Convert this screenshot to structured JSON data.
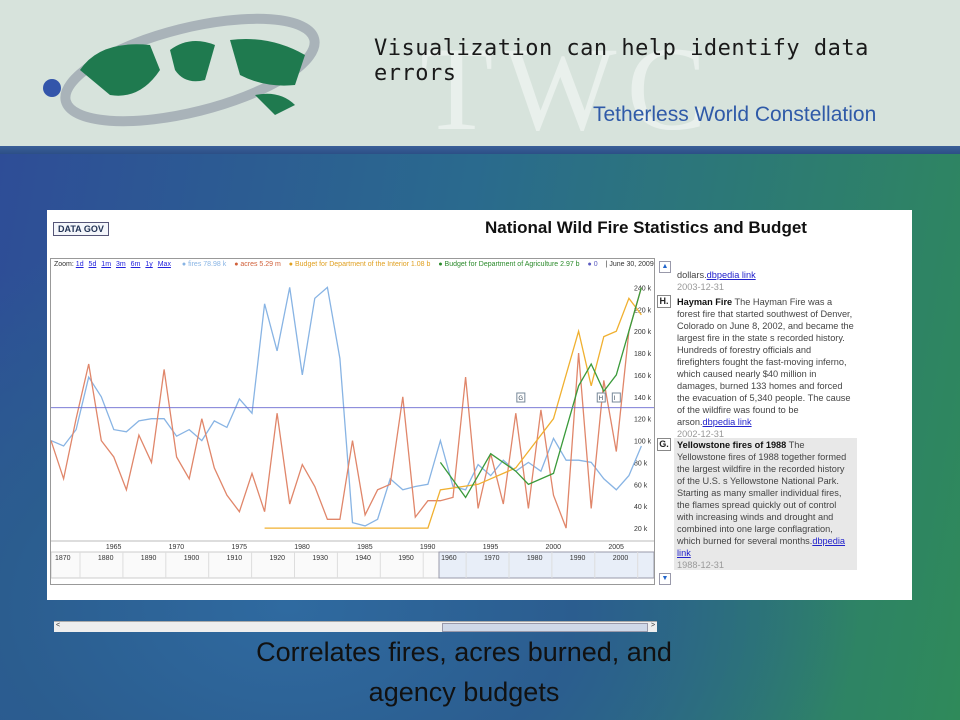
{
  "header": {
    "slide_title": "Visualization can help identify data errors",
    "org_name": "Tetherless World Constellation",
    "watermark": "TWC"
  },
  "colors": {
    "fires": "#88b4e4",
    "acres": "#e0866a",
    "interior_budget": "#f0b030",
    "agriculture_budget": "#3a9a3a",
    "zero": "#6a6ad0"
  },
  "chart": {
    "badge": "DATA GOV",
    "title": "National Wild Fire Statistics and Budget",
    "zoom_label": "Zoom:",
    "zoom_links": [
      "1d",
      "5d",
      "1m",
      "3m",
      "6m",
      "1y",
      "Max"
    ],
    "legend": [
      {
        "label": "fires 78.98 k",
        "color": "#88b4e4"
      },
      {
        "label": "acres 5.29 m",
        "color": "#e0866a"
      },
      {
        "label": "Budget for Department of the Interior 1.08 b",
        "color": "#f0b030"
      },
      {
        "label": "Budget for Department of Agriculture 2.97 b",
        "color": "#3a9a3a"
      },
      {
        "label": "0",
        "color": "#6a6ad0"
      }
    ],
    "date_label": "June 30, 2009",
    "annotations": [
      {
        "letter": "",
        "text_tail": "dollars.",
        "link": "dbpedia link",
        "date": "2003-12-31"
      },
      {
        "letter": "H.",
        "title": "Hayman Fire",
        "text": "The Hayman Fire was a forest fire that started southwest of Denver, Colorado on June 8, 2002, and became the largest fire in the state s recorded history. Hundreds of forestry officials and firefighters fought the fast-moving inferno, which caused nearly $40 million in damages, burned 133 homes and forced the evacuation of 5,340 people. The cause of the wildfire was found to be arson.",
        "link": "dbpedia link",
        "date": "2002-12-31"
      },
      {
        "letter": "G.",
        "title": "Yellowstone fires of 1988",
        "text": "The Yellowstone fires of 1988 together formed the largest wildfire in the recorded history of the U.S. s Yellowstone National Park. Starting as many smaller individual fires, the flames spread quickly out of control with increasing winds and drought and combined into one large conflagration, which burned for several months.",
        "link": "dbpedia link",
        "date": "1988-12-31"
      }
    ]
  },
  "chart_data": {
    "type": "line",
    "title": "National Wild Fire Statistics and Budget",
    "x_unit": "year",
    "y_axis_ticks": [
      "20 k",
      "40 k",
      "60 k",
      "80 k",
      "100 k",
      "120 k",
      "140 k",
      "160 k",
      "180 k",
      "200 k",
      "220 k",
      "240 k"
    ],
    "ylim": [
      10,
      255
    ],
    "x_ticks": [
      1965,
      1970,
      1975,
      1980,
      1985,
      1990,
      1995,
      2000,
      2005
    ],
    "xlim": [
      1960,
      2008
    ],
    "overview_ticks": [
      1870,
      1880,
      1890,
      1900,
      1910,
      1920,
      1930,
      1940,
      1950,
      1960,
      1970,
      1980,
      1990,
      2000
    ],
    "series": [
      {
        "name": "fires",
        "x": [
          1960,
          1961,
          1962,
          1963,
          1964,
          1965,
          1966,
          1967,
          1968,
          1969,
          1970,
          1971,
          1972,
          1973,
          1974,
          1975,
          1976,
          1977,
          1978,
          1979,
          1980,
          1981,
          1982,
          1983,
          1984,
          1985,
          1986,
          1987,
          1988,
          1989,
          1990,
          1991,
          1992,
          1993,
          1994,
          1995,
          1996,
          1997,
          1998,
          1999,
          2000,
          2001,
          2002,
          2003,
          2004,
          2005,
          2006,
          2007
        ],
        "values": [
          100,
          95,
          110,
          158,
          140,
          110,
          108,
          118,
          120,
          120,
          104,
          110,
          100,
          118,
          112,
          138,
          125,
          225,
          182,
          240,
          160,
          230,
          240,
          175,
          25,
          22,
          28,
          65,
          55,
          58,
          60,
          100,
          58,
          55,
          78,
          68,
          82,
          72,
          80,
          72,
          102,
          82,
          82,
          80,
          65,
          55,
          68,
          95
        ]
      },
      {
        "name": "acres",
        "x": [
          1960,
          1961,
          1962,
          1963,
          1964,
          1965,
          1966,
          1967,
          1968,
          1969,
          1970,
          1971,
          1972,
          1973,
          1974,
          1975,
          1976,
          1977,
          1978,
          1979,
          1980,
          1981,
          1982,
          1983,
          1984,
          1985,
          1986,
          1987,
          1988,
          1989,
          1990,
          1991,
          1992,
          1993,
          1994,
          1995,
          1996,
          1997,
          1998,
          1999,
          2000,
          2001,
          2002,
          2003,
          2004,
          2005,
          2006,
          2007
        ],
        "values": [
          100,
          65,
          120,
          170,
          100,
          85,
          55,
          105,
          80,
          165,
          85,
          65,
          120,
          75,
          50,
          35,
          70,
          35,
          125,
          42,
          78,
          58,
          28,
          28,
          100,
          32,
          55,
          60,
          140,
          30,
          45,
          45,
          48,
          158,
          38,
          88,
          42,
          125,
          38,
          128,
          50,
          20,
          180,
          38,
          155,
          90,
          200,
          240
        ]
      },
      {
        "name": "Budget for Department of the Interior",
        "x": [
          1977,
          1990,
          1991,
          1994,
          1997,
          2000,
          2002,
          2003,
          2004,
          2005,
          2006,
          2007
        ],
        "values": [
          20,
          20,
          55,
          60,
          75,
          120,
          200,
          150,
          195,
          200,
          230,
          215
        ]
      },
      {
        "name": "Budget for Department of Agriculture",
        "x": [
          1991,
          1993,
          1995,
          1997,
          1998,
          2000,
          2002,
          2003,
          2004,
          2005,
          2006,
          2007
        ],
        "values": [
          80,
          48,
          88,
          72,
          60,
          70,
          150,
          170,
          145,
          160,
          200,
          240
        ]
      },
      {
        "name": "0",
        "x": [
          1960,
          2008
        ],
        "values": [
          130,
          130
        ]
      }
    ],
    "event_markers": [
      "G",
      "H",
      "I"
    ]
  },
  "caption": {
    "line1": "Correlates fires, acres burned, and",
    "line2": "agency budgets"
  }
}
